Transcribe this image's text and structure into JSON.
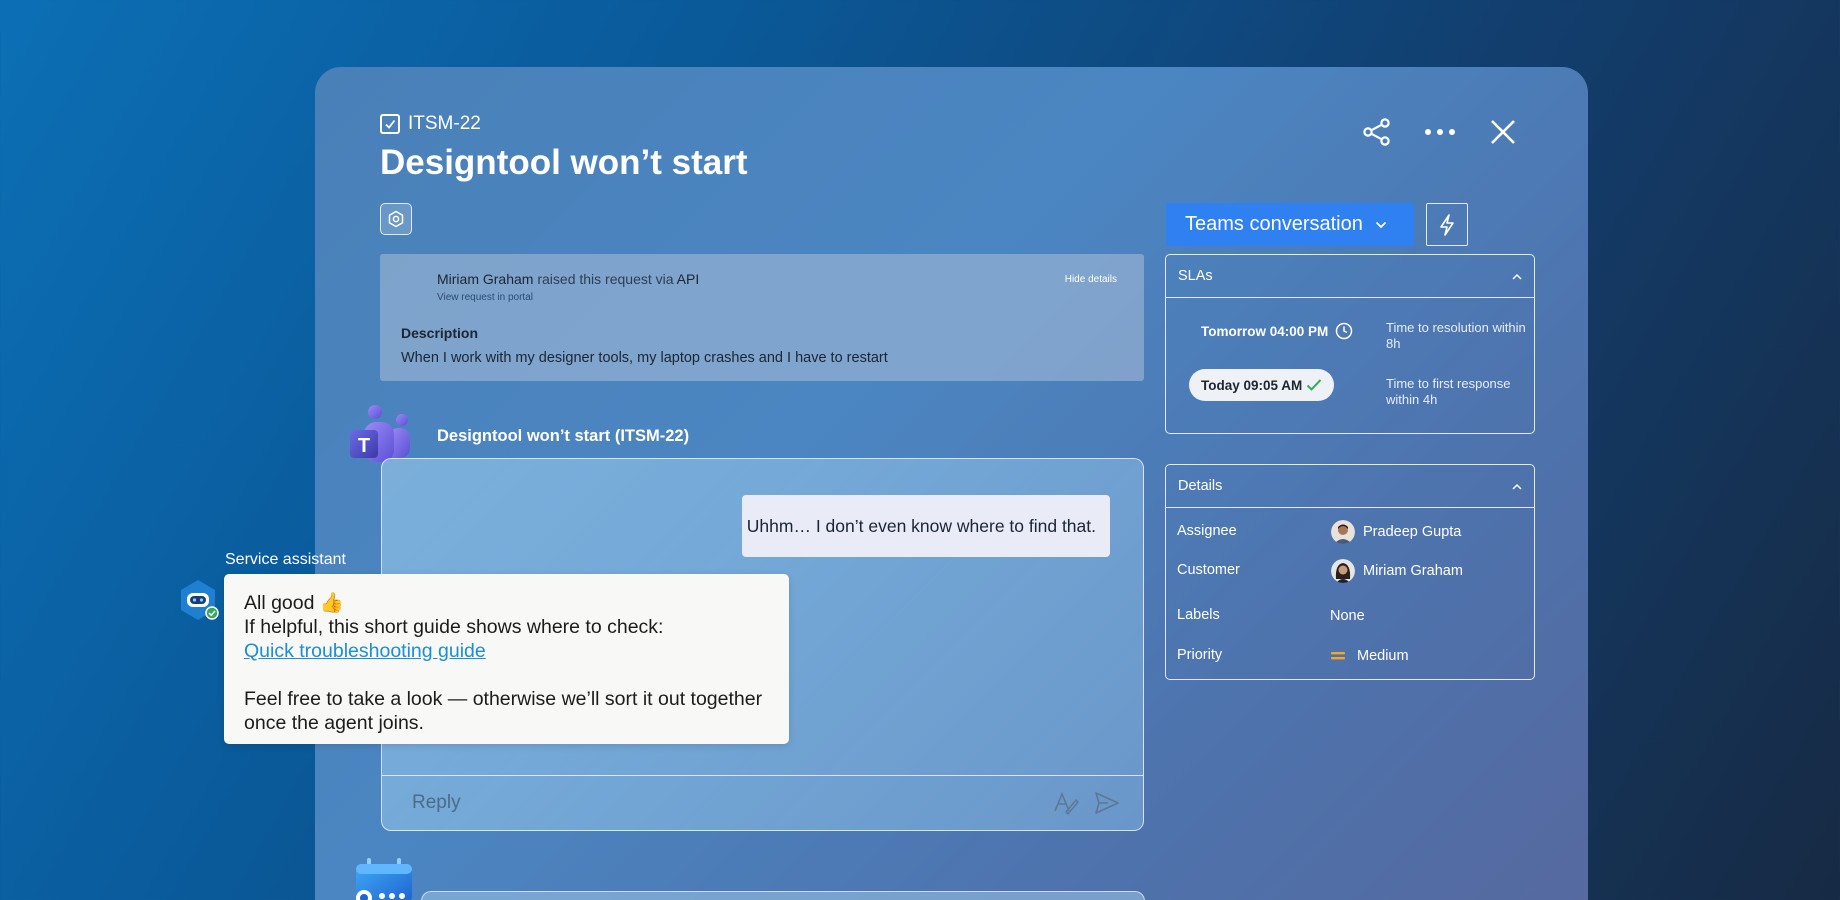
{
  "ticket": {
    "key": "ITSM-22",
    "title": "Designtool won’t start"
  },
  "header_actions": {
    "share_icon": "share-icon",
    "more_icon": "more-icon",
    "close_icon": "close-icon"
  },
  "request": {
    "raiser": "Miriam Graham",
    "raised_text": " raised this request via ",
    "channel": "API",
    "view_portal": "View request in portal",
    "hide_details": "Hide details",
    "description_label": "Description",
    "description": "When I work with my designer tools, my laptop crashes and I have to restart"
  },
  "conversation": {
    "title": "Designtool won’t start (ITSM-22)",
    "user_message": "Uhhm… I don’t even know where to find that.",
    "reply_placeholder": "Reply"
  },
  "assistant": {
    "label": "Service assistant",
    "line1": "All good 👍",
    "line2": "If helpful, this short guide shows where to check:",
    "link": "Quick troubleshooting guide",
    "line3": "Feel free to take a look — otherwise we’ll sort it out together once the agent joins."
  },
  "sidebar": {
    "teams_button": "Teams conversation",
    "slas": {
      "title": "SLAs",
      "items": [
        {
          "time": "Tomorrow 04:00 PM",
          "desc": "Time to resolution within 8h",
          "status": "pending"
        },
        {
          "time": "Today 09:05 AM",
          "desc": "Time to first response within 4h",
          "status": "met"
        }
      ]
    },
    "details": {
      "title": "Details",
      "assignee_label": "Assignee",
      "assignee": "Pradeep Gupta",
      "customer_label": "Customer",
      "customer": "Miriam Graham",
      "labels_label": "Labels",
      "labels": "None",
      "priority_label": "Priority",
      "priority": "Medium"
    }
  },
  "colors": {
    "primary_button": "#2f80f0",
    "link": "#1a8fd8",
    "priority_medium": "#f5a623",
    "sla_met": "#3aa85c"
  }
}
